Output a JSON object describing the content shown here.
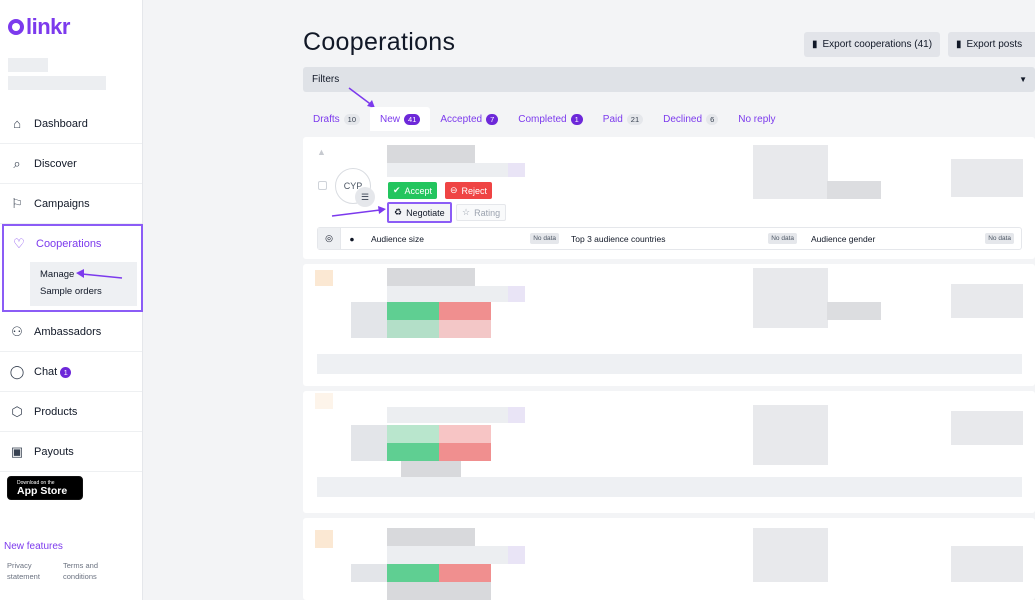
{
  "brand": {
    "name": "linkr"
  },
  "sidebar": {
    "items": [
      {
        "label": "Dashboard",
        "icon": "home-icon"
      },
      {
        "label": "Discover",
        "icon": "discover-icon"
      },
      {
        "label": "Campaigns",
        "icon": "flag-icon"
      },
      {
        "label": "Cooperations",
        "icon": "heart-icon"
      },
      {
        "label": "Ambassadors",
        "icon": "users-icon"
      },
      {
        "label": "Chat",
        "icon": "chat-icon",
        "badge": "1"
      },
      {
        "label": "Products",
        "icon": "box-icon"
      },
      {
        "label": "Payouts",
        "icon": "wallet-icon"
      }
    ],
    "subitems": [
      "Manage",
      "Sample orders"
    ],
    "appstore": {
      "small": "Download on the",
      "big": "App Store"
    },
    "new_features": "New features",
    "privacy": "Privacy statement",
    "terms": "Terms and conditions"
  },
  "main": {
    "title": "Cooperations",
    "export_cooperations": "Export cooperations (41)",
    "export_posts": "Export posts",
    "filters": "Filters",
    "tabs": [
      {
        "label": "Drafts",
        "count": "10"
      },
      {
        "label": "New",
        "count": "41"
      },
      {
        "label": "Accepted",
        "count": "7"
      },
      {
        "label": "Completed",
        "count": "1"
      },
      {
        "label": "Paid",
        "count": "21"
      },
      {
        "label": "Declined",
        "count": "6"
      },
      {
        "label": "No reply",
        "count": ""
      }
    ],
    "card": {
      "avatar": "CYP",
      "accept": "Accept",
      "reject": "Reject",
      "negotiate": "Negotiate",
      "rating": "Rating",
      "audience_size": "Audience size",
      "top_countries": "Top 3 audience countries",
      "audience_gender": "Audience gender",
      "no_data": "No data"
    }
  },
  "colors": {
    "accent": "#7c3aed",
    "accept": "#22c55e",
    "reject": "#ef4444"
  }
}
